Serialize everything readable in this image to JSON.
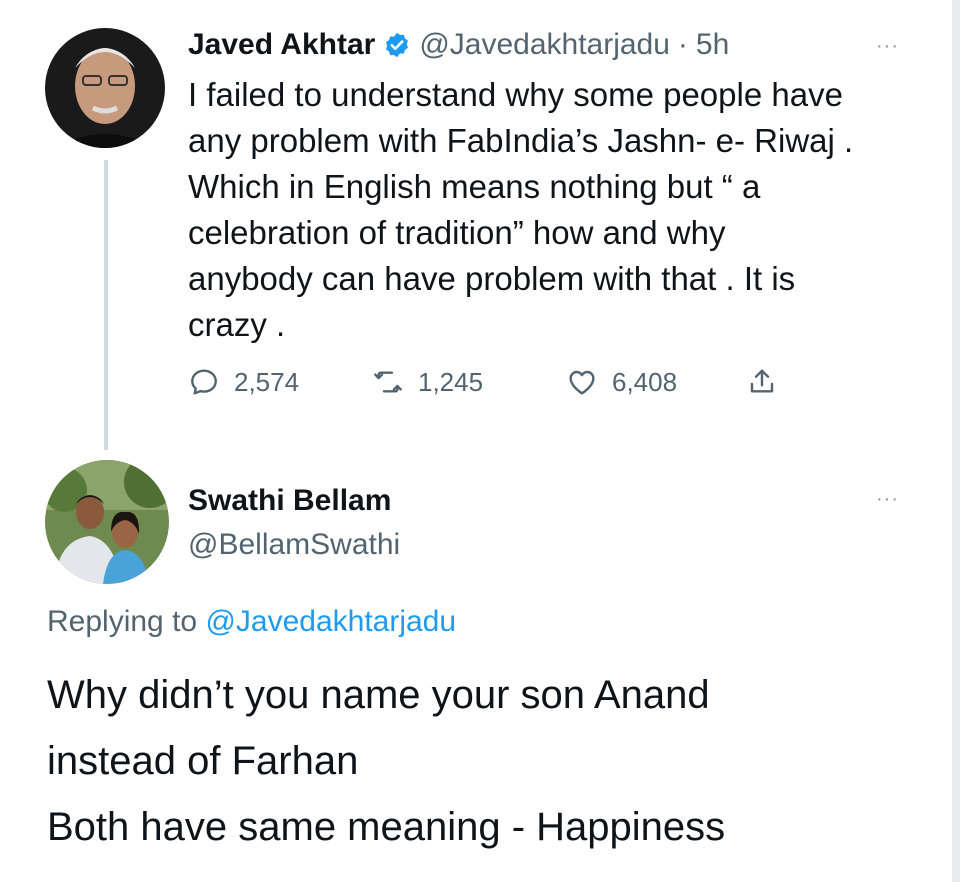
{
  "tweet": {
    "author_name": "Javed Akhtar",
    "handle": "@Javedakhtarjadu",
    "separator": "·",
    "time": "5h",
    "more": "···",
    "text_lines": [
      "I failed to understand why some people have",
      "any problem with FabIndia’s Jashn- e- Riwaj .",
      "Which in English means nothing but “ a",
      "celebration of tradition” how and why",
      "anybody can have problem with that . It is",
      "crazy ."
    ],
    "stats": {
      "replies": "2,574",
      "retweets": "1,245",
      "likes": "6,408"
    }
  },
  "reply": {
    "author_name": "Swathi Bellam",
    "handle": "@BellamSwathi",
    "more": "···",
    "replying_label": "Replying to",
    "replying_handle": "@Javedakhtarjadu",
    "text_lines": [
      "Why didn’t you name your son Anand",
      "instead of Farhan",
      "Both have same meaning - Happiness"
    ]
  },
  "colors": {
    "verified_badge": "#1d9bf0",
    "link": "#1d9bf0",
    "secondary_text": "#536471",
    "thread_line": "#cfd9de"
  }
}
